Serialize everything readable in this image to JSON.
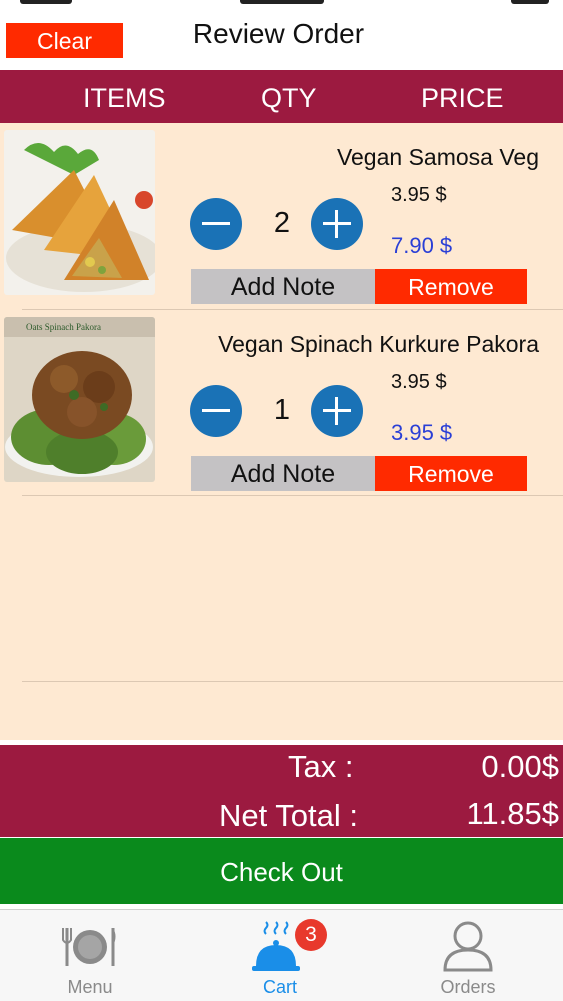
{
  "header": {
    "clear_label": "Clear",
    "title": "Review Order"
  },
  "columns": {
    "items": "ITEMS",
    "qty": "QTY",
    "price": "PRICE"
  },
  "cart_items": [
    {
      "name": "Vegan Samosa Veg",
      "qty": "2",
      "unit_price": "3.95 $",
      "line_total": "7.90 $",
      "note_label": "Add Note",
      "remove_label": "Remove"
    },
    {
      "name": "Vegan Spinach Kurkure Pakora",
      "image_caption": "Oats Spinach Pakora",
      "qty": "1",
      "unit_price": "3.95 $",
      "line_total": "3.95 $",
      "note_label": "Add Note",
      "remove_label": "Remove"
    }
  ],
  "totals": {
    "tax_label": "Tax  :",
    "tax_value": "0.00$",
    "net_label": "Net Total :",
    "net_value": "11.85$"
  },
  "checkout_label": "Check Out",
  "tabbar": {
    "menu_label": "Menu",
    "cart_label": "Cart",
    "cart_badge": "3",
    "orders_label": "Orders"
  },
  "colors": {
    "accent": "#9c1a40",
    "danger": "#ff2a00",
    "checkout": "#0a8a1c",
    "stepper": "#1a72b6",
    "price_blue": "#2a3fd6",
    "list_bg": "#fee9d2",
    "active_tab": "#1a8ee8"
  }
}
